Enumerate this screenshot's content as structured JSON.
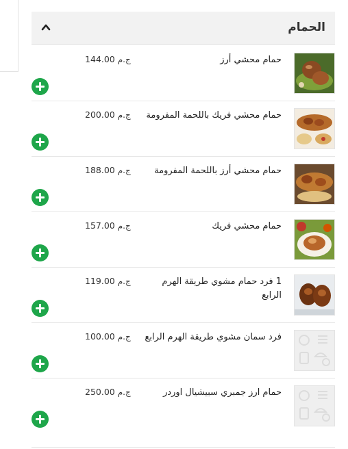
{
  "category": {
    "title": "الحمام",
    "items": [
      {
        "name": "حمام محشي أرز",
        "price": "144.00",
        "currency": "ج.م",
        "image": "stuffed-pigeon-rice-photo"
      },
      {
        "name": "حمام محشي فريك باللحمة المفرومة",
        "price": "200.00",
        "currency": "ج.م",
        "image": "stuffed-pigeon-freekeh-meat-photo"
      },
      {
        "name": "حمام محشي أرز باللحمة المفرومة",
        "price": "188.00",
        "currency": "ج.م",
        "image": "stuffed-pigeon-rice-meat-photo"
      },
      {
        "name": "حمام محشي فريك",
        "price": "157.00",
        "currency": "ج.م",
        "image": "stuffed-pigeon-freekeh-photo"
      },
      {
        "name": "1 فرد حمام مشوي طريقة الهرم الرابع",
        "price": "119.00",
        "currency": "ج.م",
        "image": "grilled-pigeon-photo"
      },
      {
        "name": "فرد سمان مشوي طريقة الهرم الرابع",
        "price": "100.00",
        "currency": "ج.م",
        "image": "food-placeholder-icon"
      },
      {
        "name": "حمام ارز جمبري سبيشيال اوردر",
        "price": "250.00",
        "currency": "ج.م",
        "image": "food-placeholder-icon"
      }
    ]
  }
}
